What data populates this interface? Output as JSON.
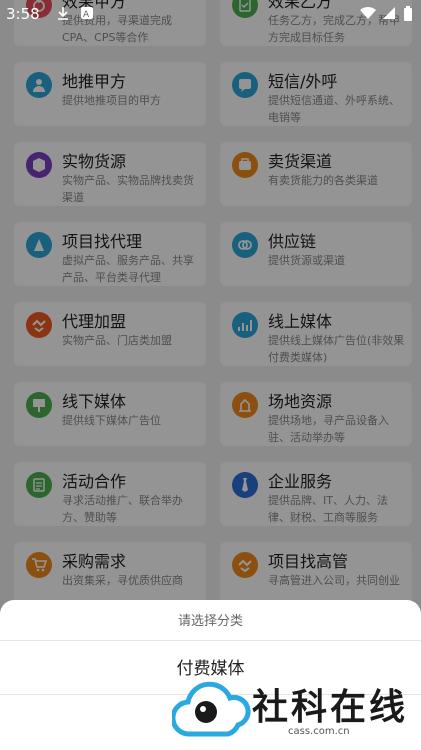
{
  "status_bar": {
    "time": "3:58"
  },
  "categories": [
    {
      "title": "效果甲方",
      "desc": "提供费用，寻渠道完成CPA、CPS等合作",
      "icon": "medal-icon",
      "color": "#e8505b"
    },
    {
      "title": "效果乙方",
      "desc": "任务乙方，完成乙方，帮甲方完成目标任务",
      "icon": "check-list-icon",
      "color": "#4caf50"
    },
    {
      "title": "地推甲方",
      "desc": "提供地推项目的甲方",
      "icon": "person-icon",
      "color": "#2ba5d6"
    },
    {
      "title": "短信/外呼",
      "desc": "提供短信通道、外呼系统、电销等",
      "icon": "sms-icon",
      "color": "#2ba5d6"
    },
    {
      "title": "实物货源",
      "desc": "实物产品、实物品牌找卖货渠道",
      "icon": "box-icon",
      "color": "#7b3fbf"
    },
    {
      "title": "卖货渠道",
      "desc": "有卖货能力的各类渠道",
      "icon": "sale-icon",
      "color": "#f08a1c"
    },
    {
      "title": "项目找代理",
      "desc": "虚拟产品、服务产品、共享产品、平台类寻代理",
      "icon": "agent-icon",
      "color": "#2ba5d6"
    },
    {
      "title": "供应链",
      "desc": "提供货源或渠道",
      "icon": "link-icon",
      "color": "#2ba5d6"
    },
    {
      "title": "代理加盟",
      "desc": "实物产品、门店类加盟",
      "icon": "handshake-icon",
      "color": "#f05a22"
    },
    {
      "title": "线上媒体",
      "desc": "提供线上媒体广告位(非效果付费类媒体)",
      "icon": "chart-icon",
      "color": "#2ba5d6"
    },
    {
      "title": "线下媒体",
      "desc": "提供线下媒体广告位",
      "icon": "billboard-icon",
      "color": "#4caf50"
    },
    {
      "title": "场地资源",
      "desc": "提供场地，寻产品设备入驻、活动举办等",
      "icon": "venue-icon",
      "color": "#f08a1c"
    },
    {
      "title": "活动合作",
      "desc": "寻求活动推广、联合举办方、赞助等",
      "icon": "event-icon",
      "color": "#4caf50"
    },
    {
      "title": "企业服务",
      "desc": "提供品牌、IT、人力、法律、财税、工商等服务",
      "icon": "tie-icon",
      "color": "#2b6fd6"
    },
    {
      "title": "采购需求",
      "desc": "出资集采，寻优质供应商",
      "icon": "cart-icon",
      "color": "#f08a1c"
    },
    {
      "title": "项目找高管",
      "desc": "寻高管进入公司，共同创业",
      "icon": "handshake-icon",
      "color": "#f08a1c"
    }
  ],
  "sheet": {
    "title": "请选择分类",
    "option": "付费媒体"
  },
  "watermark": {
    "text": "社科在线",
    "url": "cass.com.cn"
  }
}
